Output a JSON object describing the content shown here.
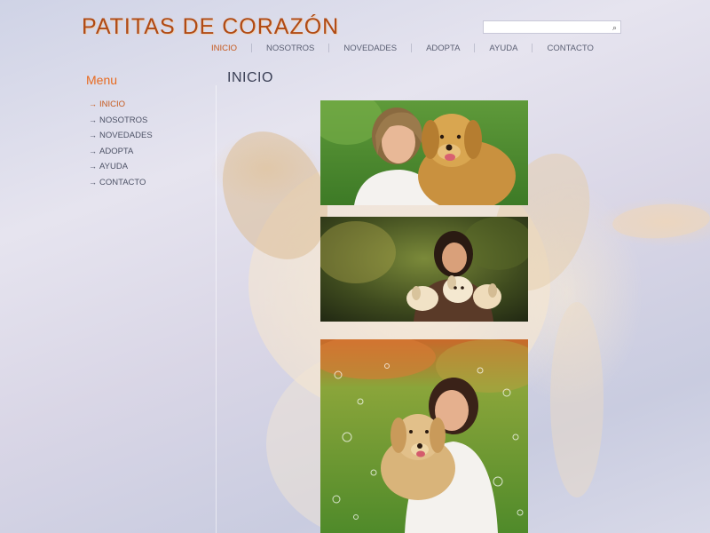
{
  "site": {
    "logo": "PATITAS DE CORAZÓN"
  },
  "search": {
    "placeholder": "",
    "value": "",
    "icon": "search-icon"
  },
  "topnav": {
    "items": [
      {
        "label": "INICIO",
        "active": true
      },
      {
        "label": "NOSOTROS"
      },
      {
        "label": "NOVEDADES"
      },
      {
        "label": "ADOPTA"
      },
      {
        "label": "AYUDA"
      },
      {
        "label": "CONTACTO"
      }
    ]
  },
  "sidebar": {
    "title": "Menu",
    "arrow": "→",
    "items": [
      {
        "label": "INICIO",
        "active": true
      },
      {
        "label": "NOSOTROS"
      },
      {
        "label": "NOVEDADES"
      },
      {
        "label": "ADOPTA"
      },
      {
        "label": "AYUDA"
      },
      {
        "label": "CONTACTO"
      }
    ]
  },
  "main": {
    "title": "INICIO",
    "photos": [
      "woman-with-golden-retriever-photo",
      "girl-with-puppies-photo",
      "woman-with-dog-in-meadow-photo"
    ]
  },
  "colors": {
    "accent": "#c65a1e",
    "logo": "#b04a14",
    "menu_title": "#e86a20",
    "text": "#5a5f73"
  }
}
